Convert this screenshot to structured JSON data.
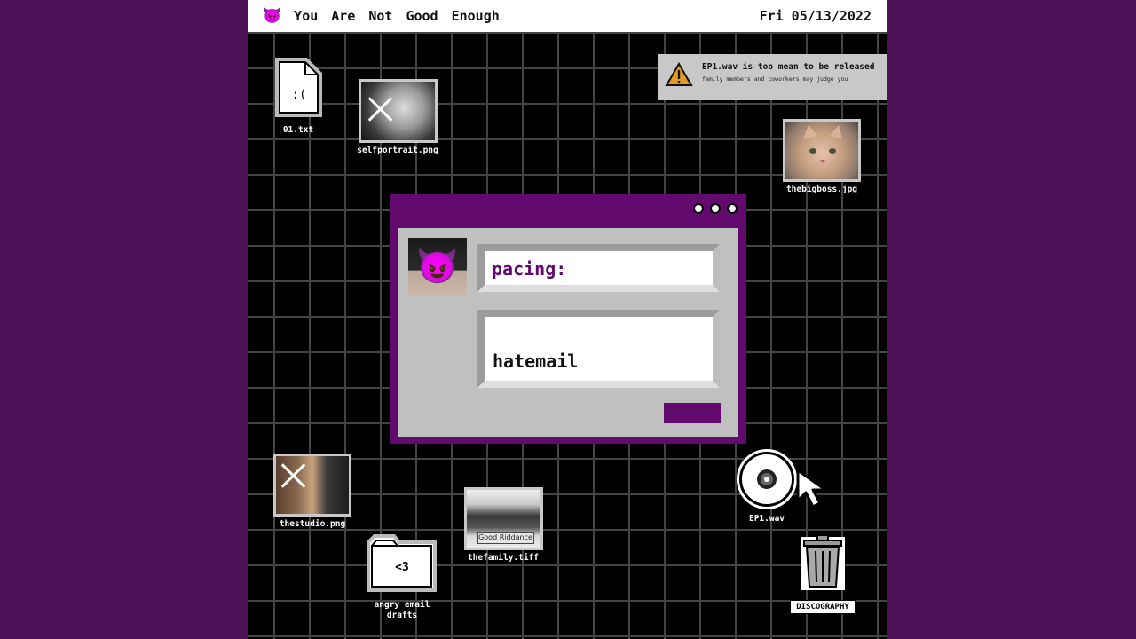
{
  "menubar": {
    "logo_emoji": "😈",
    "items": [
      "You",
      "Are",
      "Not",
      "Good",
      "Enough"
    ],
    "date": "Fri 05/13/2022"
  },
  "desktop": {
    "file_txt": {
      "label": "01.txt",
      "face": ":("
    },
    "selfportrait": {
      "label": "selfportrait.png"
    },
    "thebigboss": {
      "label": "thebigboss.jpg"
    },
    "thestudio": {
      "label": "thestudio.png"
    },
    "thefamily": {
      "label": "thefamily.tiff",
      "sign_text": "Good Riddance"
    },
    "folder": {
      "label_line1": "angry email",
      "label_line2": "drafts",
      "face": "<3"
    },
    "ep1": {
      "label": "EP1.wav"
    },
    "trash": {
      "label": "DISCOGRAPHY"
    }
  },
  "notification": {
    "title": "EP1.wav is too mean to be released",
    "subtitle": "family members and coworkers may judge you"
  },
  "dialog": {
    "avatar_emoji": "😈",
    "field1_text": "pacing:",
    "field2_text": "hatemail"
  },
  "colors": {
    "accent": "#620a6e",
    "background": "#4d1257",
    "panel": "#c0c0c0"
  }
}
